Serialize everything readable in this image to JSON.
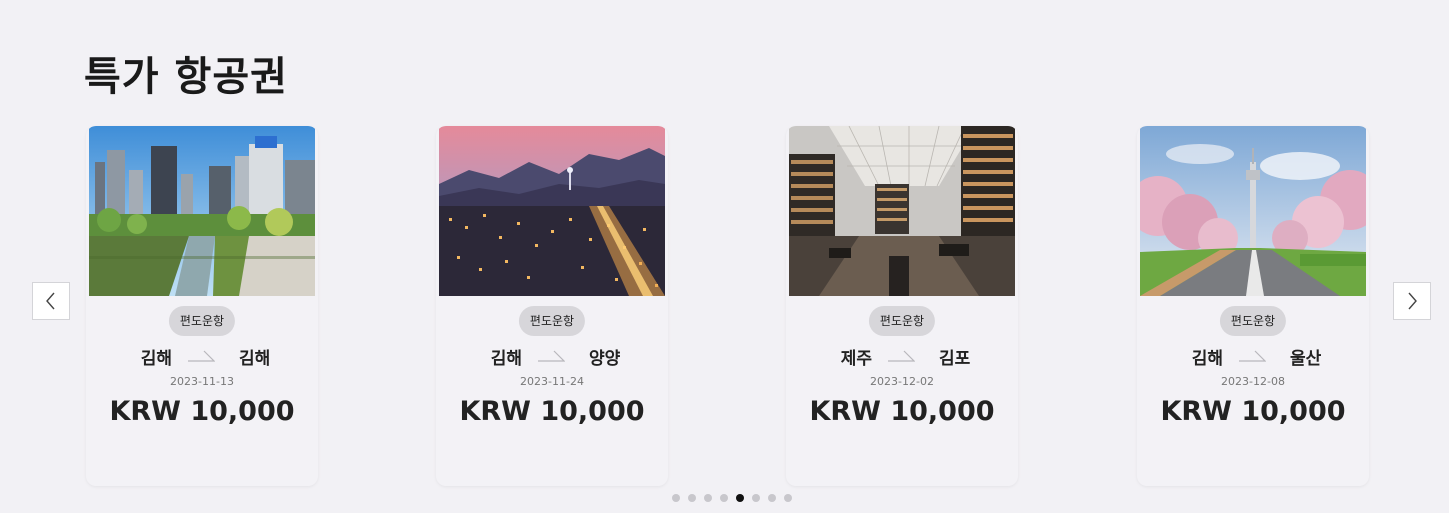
{
  "section": {
    "title": "특가 항공권"
  },
  "carousel": {
    "prev_label": "previous-arrow",
    "next_label": "next-arrow",
    "dot_count": 8,
    "active_dot": 4
  },
  "cards": [
    {
      "badge": "편도운항",
      "from": "김해",
      "to": "김해",
      "date": "2023-11-13",
      "price": "KRW 10,000",
      "image": "city-stream-photo"
    },
    {
      "badge": "편도운항",
      "from": "김해",
      "to": "양양",
      "date": "2023-11-24",
      "price": "KRW 10,000",
      "image": "city-night-photo"
    },
    {
      "badge": "편도운항",
      "from": "제주",
      "to": "김포",
      "date": "2023-12-02",
      "price": "KRW 10,000",
      "image": "library-photo"
    },
    {
      "badge": "편도운항",
      "from": "김해",
      "to": "울산",
      "date": "2023-12-08",
      "price": "KRW 10,000",
      "image": "cherry-blossom-tower-photo"
    }
  ],
  "colors": {
    "background": "#f2f1f5",
    "card": "#f3f2f6",
    "badge": "#d7d6da",
    "active_dot": "#111111",
    "inactive_dot": "#c8c7cc"
  }
}
